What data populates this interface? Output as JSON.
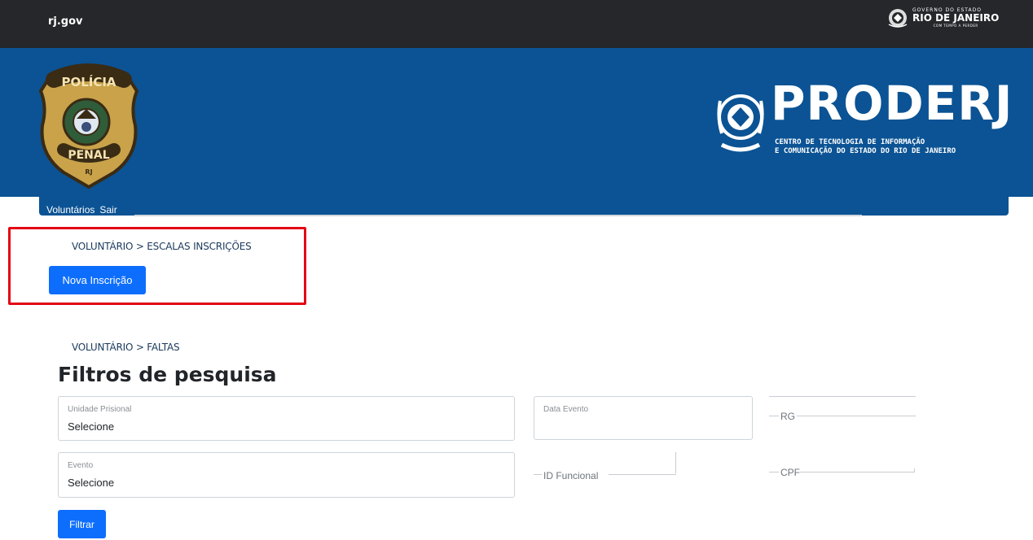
{
  "topbar": {
    "brand": "rj.gov",
    "gov_logo": {
      "line1": "GOVERNO DO ESTADO",
      "line2": "RIO DE JANEIRO",
      "line3": "COM TEMPO A PERDER",
      "icon": "state-crest-icon"
    }
  },
  "banner": {
    "badge": {
      "top_text": "POLÍCIA",
      "bottom_text": "PENAL",
      "tag": "RJ",
      "icon": "policia-penal-badge-icon",
      "colors": {
        "gold": "#c9a24a",
        "dark": "#3a2b14"
      }
    },
    "proderj": {
      "title": "PRODERJ",
      "subtitle_line1": "CENTRO DE TECNOLOGIA DE INFORMAÇÃO",
      "subtitle_line2": "E COMUNICAÇÃO DO ESTADO DO RIO DE JANEIRO",
      "icon": "proderj-crest-icon"
    },
    "color": "#0b5394"
  },
  "nav": {
    "items": [
      {
        "label": "Voluntários"
      },
      {
        "label": "Sair"
      }
    ]
  },
  "section1": {
    "breadcrumb": "VOLUNTÁRIO > ESCALAS INSCRIÇÕES",
    "new_button": "Nova Inscrição",
    "highlight_color": "#e30613"
  },
  "section2": {
    "breadcrumb": "VOLUNTÁRIO > FALTAS",
    "title": "Filtros de pesquisa",
    "fields": {
      "unidade": {
        "label": "Unidade Prisional",
        "value": "Selecione"
      },
      "data": {
        "label": "Data Evento"
      },
      "rg": {
        "label": "RG"
      },
      "evento": {
        "label": "Evento",
        "value": "Selecione"
      },
      "id_funcional": {
        "label": "ID Funcional"
      },
      "cpf": {
        "label": "CPF"
      }
    },
    "filter_button": "Filtrar"
  },
  "colors": {
    "primary_button": "#0d6efd",
    "topbar": "#25272b"
  }
}
